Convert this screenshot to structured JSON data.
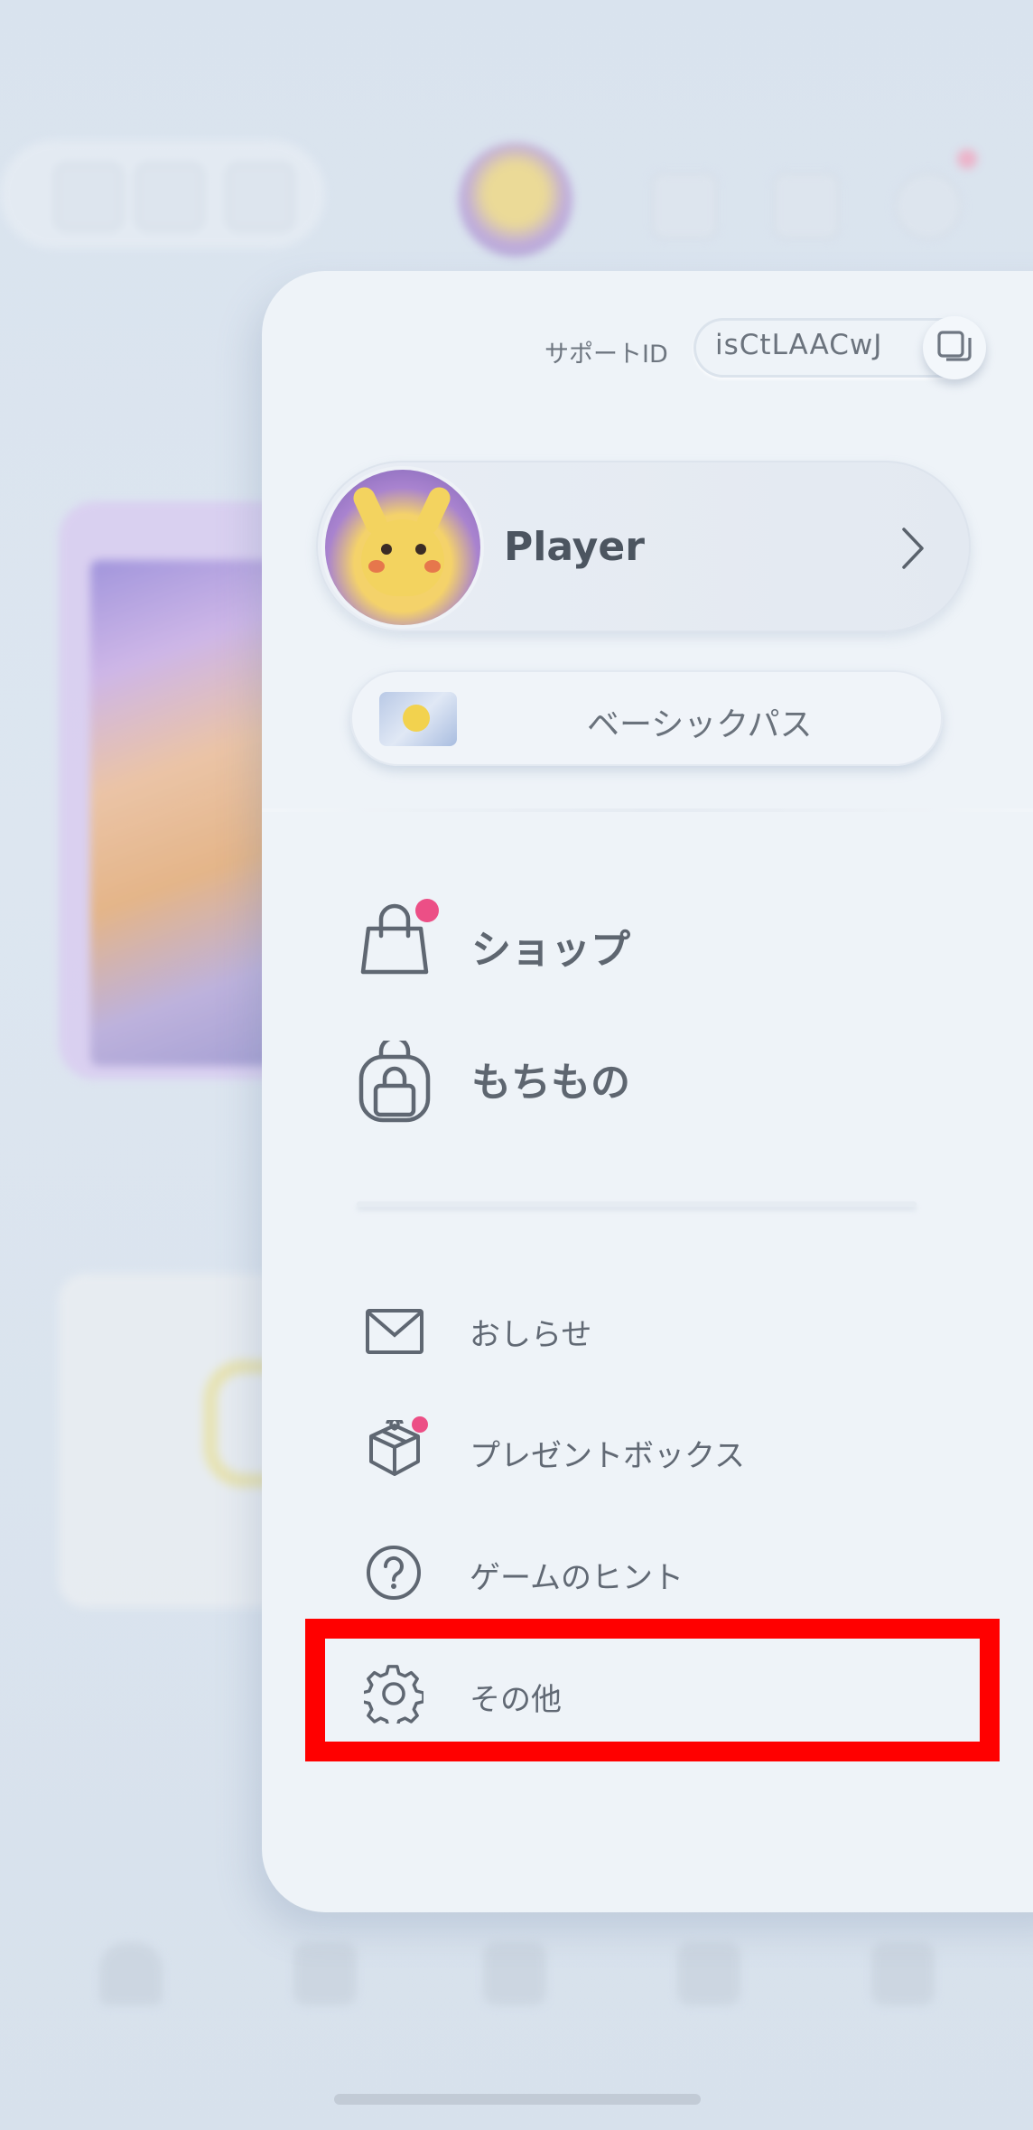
{
  "drawer": {
    "support_id_label": "サポートID",
    "support_id_value": "isCtLAACwJ",
    "player_name": "Player",
    "pass_label": "ベーシックパス"
  },
  "main_menu": [
    {
      "label": "ショップ",
      "icon": "shopping-bag-icon",
      "has_notification": true
    },
    {
      "label": "もちもの",
      "icon": "backpack-icon",
      "has_notification": false
    }
  ],
  "sub_menu": [
    {
      "label": "おしらせ",
      "icon": "mail-icon",
      "has_notification": false
    },
    {
      "label": "プレゼントボックス",
      "icon": "gift-icon",
      "has_notification": true
    },
    {
      "label": "ゲームのヒント",
      "icon": "help-circle-icon",
      "has_notification": false
    },
    {
      "label": "その他",
      "icon": "gear-icon",
      "has_notification": false,
      "highlighted": true
    }
  ],
  "colors": {
    "notification_dot": "#ec4f86",
    "highlight_border": "#ff0000",
    "panel_background": "#eef3f8"
  }
}
